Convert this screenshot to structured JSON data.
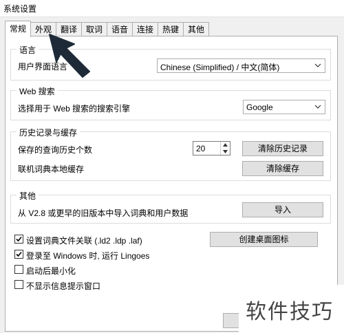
{
  "window": {
    "title": "系统设置"
  },
  "tabs": [
    {
      "label": "常规",
      "active": true
    },
    {
      "label": "外观"
    },
    {
      "label": "翻译"
    },
    {
      "label": "取词"
    },
    {
      "label": "语音"
    },
    {
      "label": "连接"
    },
    {
      "label": "热键"
    },
    {
      "label": "其他"
    }
  ],
  "language_group": {
    "title": "语言",
    "ui_language_label": "用户界面语言",
    "ui_language_value": "Chinese (Simplified)  /  中文(简体)"
  },
  "web_search_group": {
    "title": "Web 搜索",
    "engine_label": "选择用于 Web 搜索的搜索引擎",
    "engine_value": "Google"
  },
  "history_group": {
    "title": "历史记录与缓存",
    "history_count_label": "保存的查询历史个数",
    "history_count_value": "20",
    "clear_history_button": "清除历史记录",
    "cache_label": "联机词典本地缓存",
    "clear_cache_button": "清除缓存"
  },
  "other_group": {
    "title": "其他",
    "import_label": "从 V2.8 或更早的旧版本中导入词典和用户数据",
    "import_button": "导入"
  },
  "options": [
    {
      "label": "设置词典文件关联 (.ld2 .ldp .laf)",
      "checked": true
    },
    {
      "label": "登录至 Windows 时, 运行 Lingoes",
      "checked": true
    },
    {
      "label": "启动后最小化",
      "checked": false
    },
    {
      "label": "不显示信息提示窗口",
      "checked": false
    }
  ],
  "create_shortcut_button": "创建桌面图标",
  "watermark_text": "软件技巧"
}
